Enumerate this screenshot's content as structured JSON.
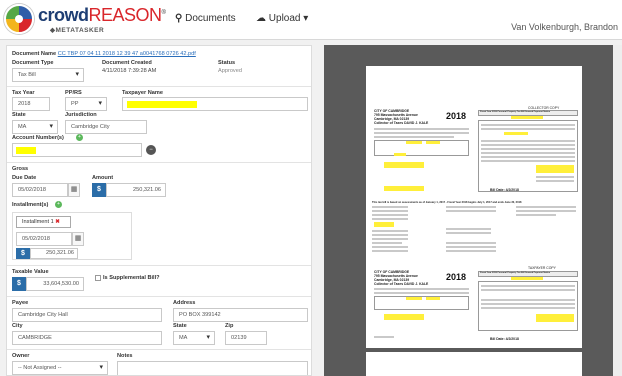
{
  "app": {
    "brand_main": "crowd",
    "brand_accent": "REASON",
    "brand_sub": "METATASKER"
  },
  "nav": {
    "documents": "Documents",
    "upload": "Upload"
  },
  "user": {
    "name": "Van Volkenburgh, Brandon"
  },
  "document": {
    "name_label": "Document Name",
    "name_value": "CC TBP 07 04 11 2018 12 39 47 a0041768 0726 42.pdf",
    "type_label": "Document Type",
    "type_value": "Tax Bill",
    "created_label": "Document Created",
    "created_value": "4/11/2018 7:39:28 AM",
    "status_label": "Status",
    "status_value": "Approved"
  },
  "tax": {
    "year_label": "Tax Year",
    "year_value": "2018",
    "pprs_label": "PP/RS",
    "pprs_value": "PP",
    "taxpayer_label": "Taxpayer Name",
    "state_label": "State",
    "state_value": "MA",
    "jurisdiction_label": "Jurisdiction",
    "jurisdiction_value": "Cambridge City",
    "account_label": "Account Number(s)"
  },
  "gross": {
    "section_label": "Gross",
    "due_label": "Due Date",
    "due_value": "05/02/2018",
    "amount_label": "Amount",
    "amount_value": "250,321.06"
  },
  "installments": {
    "label": "Installment(s)",
    "tab_label": "Installment 1",
    "date_value": "05/02/2018",
    "amount_value": "250,321.06"
  },
  "taxable": {
    "label": "Taxable Value",
    "value": "33,604,530.00",
    "supplemental_label": "Is Supplemental Bill?"
  },
  "payee": {
    "label": "Payee",
    "value": "Cambridge City Hall",
    "address_label": "Address",
    "address_value": "PO BOX 399142",
    "city_label": "City",
    "city_value": "CAMBRIDGE",
    "state_label": "State",
    "state_value": "MA",
    "zip_label": "Zip",
    "zip_value": "02139"
  },
  "owner": {
    "label": "Owner",
    "value": "-- Not Assigned --",
    "notes_label": "Notes"
  },
  "preview": {
    "page1": {
      "city": "CITY OF CAMBRIDGE",
      "address": "795 Massachusetts Avenue",
      "citystate": "Cambridge, MA 02139",
      "collector": "Collector of Taxes DAVID J. KALE",
      "year": "2018",
      "header": "Fiscal Year 2018 Personal Property Tax Bill Second Payment Notice",
      "copy": "COLLECTOR COPY",
      "bill_date": "Bill Date: 4/2/2018",
      "info": "This tax bill is based on assessments as of January 1, 2017 - Fiscal Year 2018 begins July 1, 2017 and ends June 30, 2018"
    },
    "page2": {
      "city": "CITY OF CAMBRIDGE",
      "address": "795 Massachusetts Avenue",
      "citystate": "Cambridge, MA 02139",
      "collector": "Collector of Taxes DAVID J. KALE",
      "year": "2018",
      "header": "Fiscal Year 2018 Personal Property Tax Bill Second Payment Notice",
      "copy": "TAXPAYER COPY",
      "bill_date": "Bill Date: 4/2/2018"
    }
  },
  "colors": {
    "accent": "#2b6da8",
    "highlight": "#ffff00",
    "viewer_bg": "#5a5a5a",
    "brand_red": "#d9262b",
    "brand_blue": "#1e3e73"
  },
  "icons": {
    "search": "search-icon",
    "upload": "upload-icon",
    "calendar": "calendar-icon",
    "dollar": "dollar-icon",
    "remove": "remove-icon",
    "add": "add-icon",
    "settings": "settings-icon"
  }
}
